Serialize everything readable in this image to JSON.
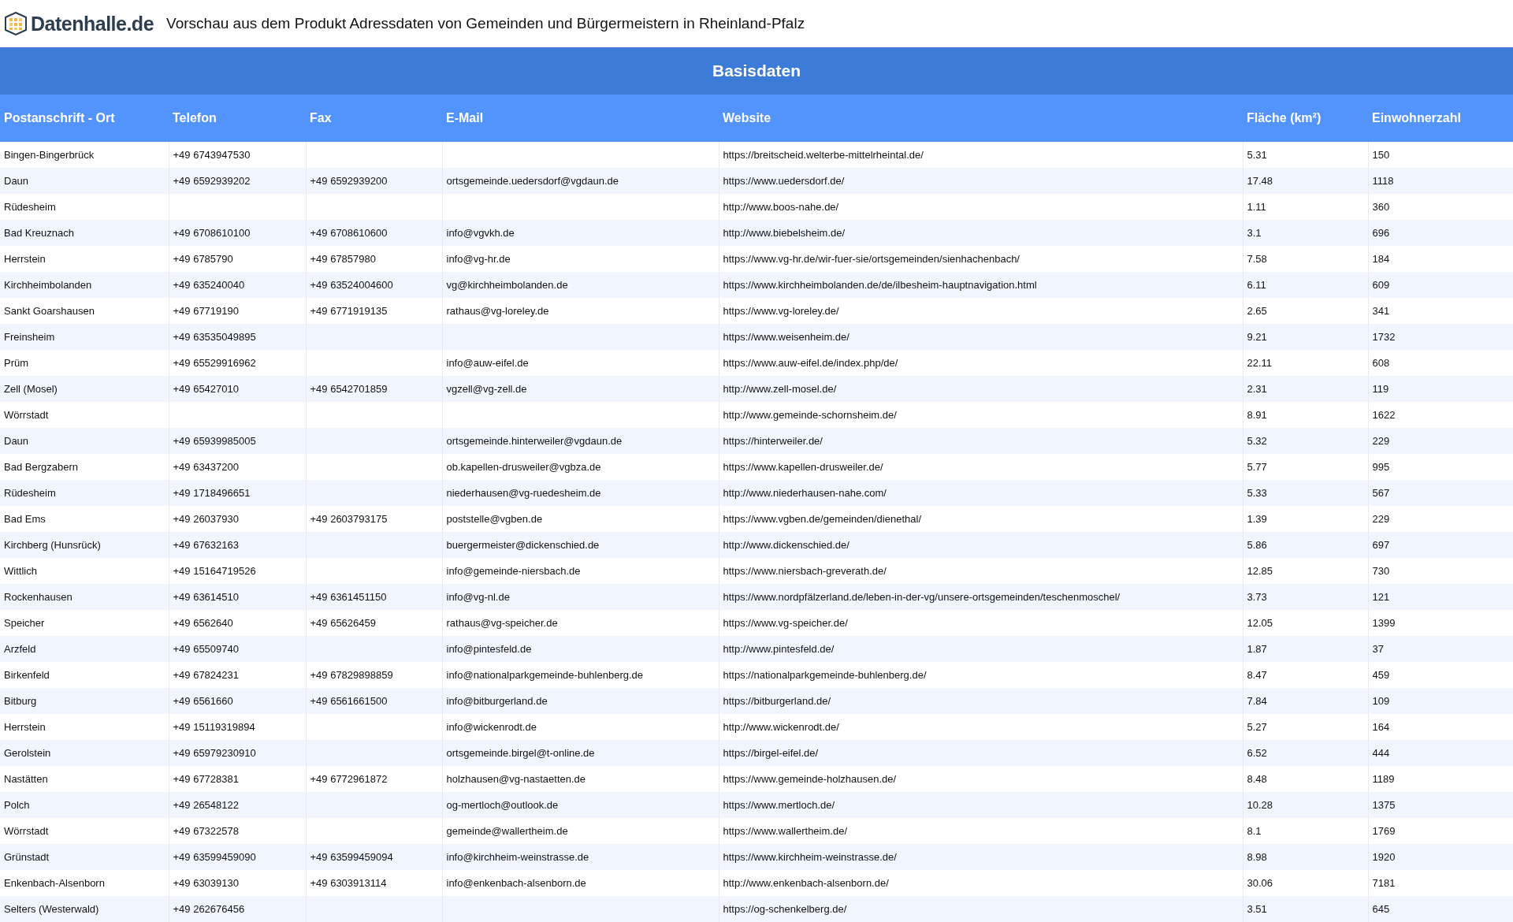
{
  "header": {
    "logo": "Datenhalle.de",
    "title": "Vorschau aus dem Produkt Adressdaten von Gemeinden und Bürgermeistern in Rheinland-Pfalz"
  },
  "table": {
    "group_heading": "Basisdaten",
    "columns": [
      "Postanschrift - Ort",
      "Telefon",
      "Fax",
      "E-Mail",
      "Website",
      "Fläche (km²)",
      "Einwohnerzahl"
    ],
    "rows": [
      [
        "Bingen-Bingerbrück",
        "+49 6743947530",
        null,
        null,
        "https://breitscheid.welterbe-mittelrheintal.de/",
        "5.31",
        "150"
      ],
      [
        "Daun",
        "+49 6592939202",
        "+49 6592939200",
        "ortsgemeinde.uedersdorf@vgdaun.de",
        "https://www.uedersdorf.de/",
        "17.48",
        "1118"
      ],
      [
        "Rüdesheim",
        null,
        null,
        null,
        "http://www.boos-nahe.de/",
        "1.11",
        "360"
      ],
      [
        "Bad Kreuznach",
        "+49 6708610100",
        "+49 6708610600",
        "info@vgvkh.de",
        "http://www.biebelsheim.de/",
        "3.1",
        "696"
      ],
      [
        "Herrstein",
        "+49 6785790",
        "+49 67857980",
        "info@vg-hr.de",
        "https://www.vg-hr.de/wir-fuer-sie/ortsgemeinden/sienhachenbach/",
        "7.58",
        "184"
      ],
      [
        "Kirchheimbolanden",
        "+49 635240040",
        "+49 63524004600",
        "vg@kirchheimbolanden.de",
        "https://www.kirchheimbolanden.de/de/ilbesheim-hauptnavigation.html",
        "6.11",
        "609"
      ],
      [
        "Sankt Goarshausen",
        "+49 67719190",
        "+49 6771919135",
        "rathaus@vg-loreley.de",
        "https://www.vg-loreley.de/",
        "2.65",
        "341"
      ],
      [
        "Freinsheim",
        "+49 63535049895",
        null,
        null,
        "https://www.weisenheim.de/",
        "9.21",
        "1732"
      ],
      [
        "Prüm",
        "+49 65529916962",
        null,
        "info@auw-eifel.de",
        "https://www.auw-eifel.de/index.php/de/",
        "22.11",
        "608"
      ],
      [
        "Zell (Mosel)",
        "+49 65427010",
        "+49 6542701859",
        "vgzell@vg-zell.de",
        "http://www.zell-mosel.de/",
        "2.31",
        "119"
      ],
      [
        "Wörrstadt",
        null,
        null,
        null,
        "http://www.gemeinde-schornsheim.de/",
        "8.91",
        "1622"
      ],
      [
        "Daun",
        "+49 65939985005",
        null,
        "ortsgemeinde.hinterweiler@vgdaun.de",
        "https://hinterweiler.de/",
        "5.32",
        "229"
      ],
      [
        "Bad Bergzabern",
        "+49 63437200",
        null,
        "ob.kapellen-drusweiler@vgbza.de",
        "https://www.kapellen-drusweiler.de/",
        "5.77",
        "995"
      ],
      [
        "Rüdesheim",
        "+49 1718496651",
        null,
        "niederhausen@vg-ruedesheim.de",
        "http://www.niederhausen-nahe.com/",
        "5.33",
        "567"
      ],
      [
        "Bad Ems",
        "+49 26037930",
        "+49 2603793175",
        "poststelle@vgben.de",
        "https://www.vgben.de/gemeinden/dienethal/",
        "1.39",
        "229"
      ],
      [
        "Kirchberg (Hunsrück)",
        "+49 67632163",
        null,
        "buergermeister@dickenschied.de",
        "http://www.dickenschied.de/",
        "5.86",
        "697"
      ],
      [
        "Wittlich",
        "+49 15164719526",
        null,
        "info@gemeinde-niersbach.de",
        "https://www.niersbach-greverath.de/",
        "12.85",
        "730"
      ],
      [
        "Rockenhausen",
        "+49 63614510",
        "+49 6361451150",
        "info@vg-nl.de",
        "https://www.nordpfälzerland.de/leben-in-der-vg/unsere-ortsgemeinden/teschenmoschel/",
        "3.73",
        "121"
      ],
      [
        "Speicher",
        "+49 6562640",
        "+49 65626459",
        "rathaus@vg-speicher.de",
        "https://www.vg-speicher.de/",
        "12.05",
        "1399"
      ],
      [
        "Arzfeld",
        "+49 65509740",
        null,
        "info@pintesfeld.de",
        "http://www.pintesfeld.de/",
        "1.87",
        "37"
      ],
      [
        "Birkenfeld",
        "+49 67824231",
        "+49 67829898859",
        "info@nationalparkgemeinde-buhlenberg.de",
        "https://nationalparkgemeinde-buhlenberg.de/",
        "8.47",
        "459"
      ],
      [
        "Bitburg",
        "+49 6561660",
        "+49 6561661500",
        "info@bitburgerland.de",
        "https://bitburgerland.de/",
        "7.84",
        "109"
      ],
      [
        "Herrstein",
        "+49 15119319894",
        null,
        "info@wickenrodt.de",
        "http://www.wickenrodt.de/",
        "5.27",
        "164"
      ],
      [
        "Gerolstein",
        "+49 65979230910",
        null,
        "ortsgemeinde.birgel@t-online.de",
        "https://birgel-eifel.de/",
        "6.52",
        "444"
      ],
      [
        "Nastätten",
        "+49 67728381",
        "+49 6772961872",
        "holzhausen@vg-nastaetten.de",
        "https://www.gemeinde-holzhausen.de/",
        "8.48",
        "1189"
      ],
      [
        "Polch",
        "+49 26548122",
        null,
        "og-mertloch@outlook.de",
        "https://www.mertloch.de/",
        "10.28",
        "1375"
      ],
      [
        "Wörrstadt",
        "+49 67322578",
        null,
        "gemeinde@wallertheim.de",
        "https://www.wallertheim.de/",
        "8.1",
        "1769"
      ],
      [
        "Grünstadt",
        "+49 63599459090",
        "+49 63599459094",
        "info@kirchheim-weinstrasse.de",
        "https://www.kirchheim-weinstrasse.de/",
        "8.98",
        "1920"
      ],
      [
        "Enkenbach-Alsenborn",
        "+49 63039130",
        "+49 6303913114",
        "info@enkenbach-alsenborn.de",
        "http://www.enkenbach-alsenborn.de/",
        "30.06",
        "7181"
      ],
      [
        "Selters (Westerwald)",
        "+49 262676456",
        null,
        null,
        "https://og-schenkelberg.de/",
        "3.51",
        "645"
      ]
    ]
  }
}
